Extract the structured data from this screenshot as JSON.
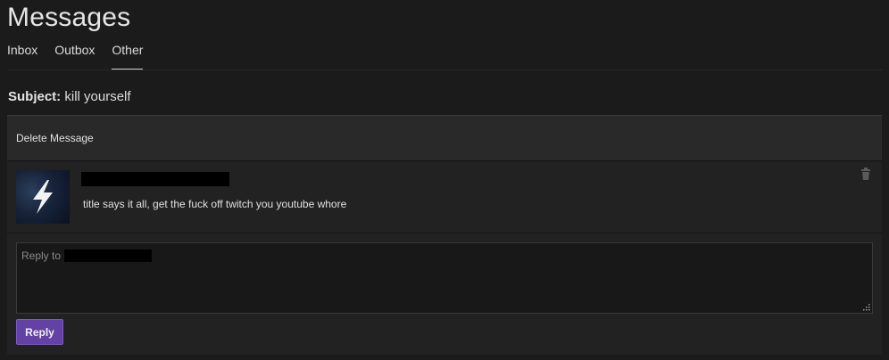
{
  "page": {
    "title": "Messages"
  },
  "tabs": [
    {
      "label": "Inbox",
      "active": false
    },
    {
      "label": "Outbox",
      "active": false
    },
    {
      "label": "Other",
      "active": true
    }
  ],
  "subject": {
    "label": "Subject:",
    "value": "kill yourself"
  },
  "actions": {
    "delete_label": "Delete Message"
  },
  "message": {
    "avatar_icon": "lightning-bolt-icon",
    "body": "title says it all, get the fuck off twitch you youtube whore",
    "delete_icon": "trash-icon"
  },
  "reply": {
    "placeholder_prefix": "Reply to",
    "button_label": "Reply"
  },
  "colors": {
    "background": "#1b1b1b",
    "panel": "#222222",
    "accent": "#6441a4"
  }
}
